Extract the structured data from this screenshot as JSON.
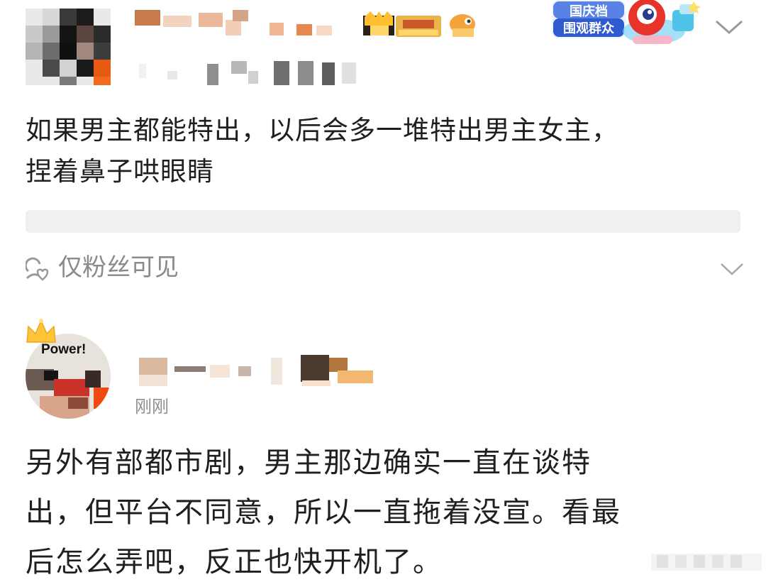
{
  "post1": {
    "text_lines": [
      "如果男主都能特出，以后会多一堆特出男主女主，",
      "捏着鼻子哄眼睛"
    ],
    "visibility_label": "仅粉丝可见",
    "event_badge": {
      "line1": "国庆档",
      "line2": "围观群众"
    }
  },
  "post2": {
    "avatar_badge": "Power!",
    "timestamp": "刚刚",
    "text_lines": [
      "另外有部都市剧，男主那边确实一直在谈特",
      "出，但平台不同意，所以一直拖着没宣。看最",
      "后怎么弄吧，反正也快开机了。"
    ]
  },
  "icons": {
    "options": "chevron-down-icon",
    "visibility": "fans-only-icon",
    "crown": "crown-icon"
  },
  "colors": {
    "text": "#1f1f1f",
    "muted": "#8a8a8a",
    "accent_orange": "#f26b1d"
  }
}
